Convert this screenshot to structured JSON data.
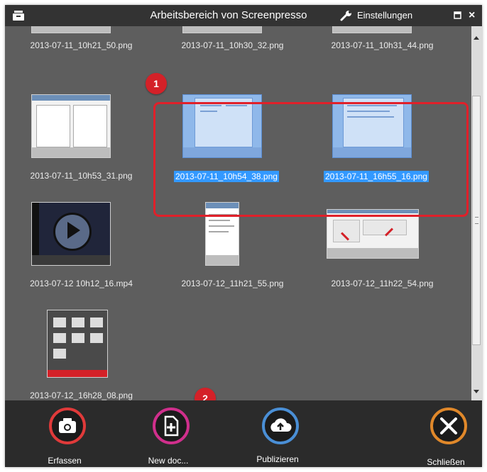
{
  "window": {
    "title": "Arbeitsbereich von Screenpresso",
    "settings_label": "Einstellungen",
    "close_glyph": "×"
  },
  "files": [
    {
      "name": "2013-07-11_10h21_50.png",
      "selected": false
    },
    {
      "name": "2013-07-11_10h30_32.png",
      "selected": false
    },
    {
      "name": "2013-07-11_10h31_44.png",
      "selected": false
    },
    {
      "name": "2013-07-11_10h53_31.png",
      "selected": false
    },
    {
      "name": "2013-07-11_10h54_38.png",
      "selected": true
    },
    {
      "name": "2013-07-11_16h55_16.png",
      "selected": true
    },
    {
      "name": "2013-07-12 10h12_16.mp4",
      "selected": false
    },
    {
      "name": "2013-07-12_11h21_55.png",
      "selected": false
    },
    {
      "name": "2013-07-12_11h22_54.png",
      "selected": false
    },
    {
      "name": "2013-07-12_16h28_08.png",
      "selected": false
    }
  ],
  "annotations": {
    "badge_1": "1",
    "badge_2": "2"
  },
  "toolbar": {
    "capture_label": "Erfassen",
    "new_doc_label": "New doc...",
    "publish_label": "Publizieren",
    "close_label": "Schließen"
  },
  "icons": {
    "title": "tray-icon",
    "settings": "wrench-icon",
    "capture": "camera-icon",
    "new_doc": "add-document-icon",
    "publish": "cloud-upload-icon",
    "close": "close-icon"
  },
  "colors": {
    "selection": "#3399ff",
    "annotation_red": "#d42128",
    "capture_ring": "#e03a3a",
    "new_doc_ring": "#d02f8c",
    "publish_ring": "#4a8fd6",
    "close_ring": "#e0882a"
  }
}
